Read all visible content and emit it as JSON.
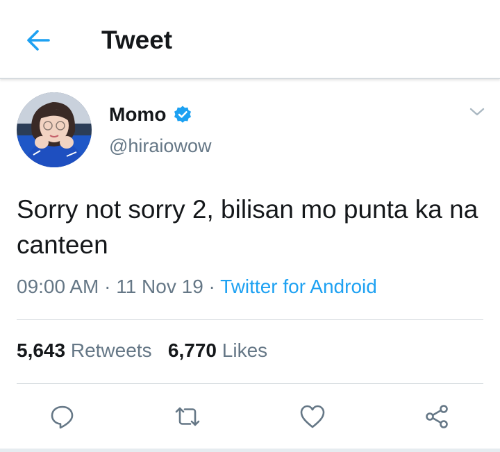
{
  "header": {
    "title": "Tweet",
    "back_icon": "back-arrow-icon"
  },
  "colors": {
    "accent": "#1da1f2",
    "text": "#14171a",
    "secondary": "#657786",
    "divider": "#d6dbdf"
  },
  "author": {
    "display_name": "Momo",
    "handle": "@hiraiowow",
    "verified": true,
    "avatar": "profile-photo"
  },
  "tweet": {
    "text": "Sorry not sorry 2, bilisan mo punta ka na canteen",
    "time": "09:00 AM",
    "sep1": " · ",
    "date": "11 Nov 19",
    "sep2": " · ",
    "source": "Twitter for Android"
  },
  "stats": {
    "retweets_count": "5,643",
    "retweets_label": "Retweets",
    "likes_count": "6,770",
    "likes_label": "Likes"
  },
  "actions": [
    "reply-icon",
    "retweet-icon",
    "like-icon",
    "share-icon"
  ]
}
